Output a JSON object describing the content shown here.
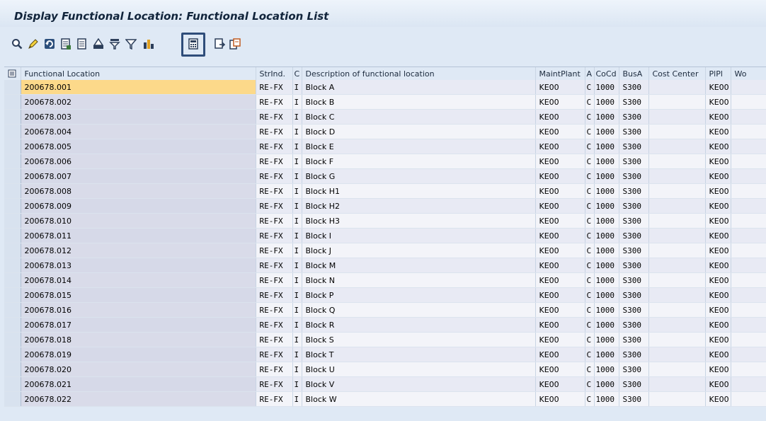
{
  "window": {
    "title": "Display Functional Location: Functional Location List"
  },
  "toolbar": {
    "buttons": [
      {
        "icon": "details-magnifier-icon"
      },
      {
        "icon": "edit-pencil-icon"
      },
      {
        "icon": "refresh-icon"
      },
      {
        "icon": "select-layout-icon"
      },
      {
        "icon": "choose-layout-icon"
      },
      {
        "icon": "print-icon"
      },
      {
        "icon": "filter-icon"
      },
      {
        "icon": "set-filter-icon"
      },
      {
        "icon": "chart-icon"
      },
      {
        "icon": "spreadsheet-icon"
      },
      {
        "icon": "export-icon"
      },
      {
        "icon": "local-file-icon"
      }
    ]
  },
  "table": {
    "columns": [
      "Functional Location",
      "StrInd.",
      "C",
      "Description of functional location",
      "MaintPlant",
      "A",
      "CoCd",
      "BusA",
      "Cost Center",
      "PlPl",
      "Wo"
    ],
    "rows": [
      [
        "200678.001",
        "RE-FX",
        "I",
        "Block A",
        "KE00",
        "C",
        "1000",
        "S300",
        "",
        "KE00",
        ""
      ],
      [
        "200678.002",
        "RE-FX",
        "I",
        "Block B",
        "KE00",
        "C",
        "1000",
        "S300",
        "",
        "KE00",
        ""
      ],
      [
        "200678.003",
        "RE-FX",
        "I",
        "Block C",
        "KE00",
        "C",
        "1000",
        "S300",
        "",
        "KE00",
        ""
      ],
      [
        "200678.004",
        "RE-FX",
        "I",
        "Block D",
        "KE00",
        "C",
        "1000",
        "S300",
        "",
        "KE00",
        ""
      ],
      [
        "200678.005",
        "RE-FX",
        "I",
        "Block E",
        "KE00",
        "C",
        "1000",
        "S300",
        "",
        "KE00",
        ""
      ],
      [
        "200678.006",
        "RE-FX",
        "I",
        "Block F",
        "KE00",
        "C",
        "1000",
        "S300",
        "",
        "KE00",
        ""
      ],
      [
        "200678.007",
        "RE-FX",
        "I",
        "Block G",
        "KE00",
        "C",
        "1000",
        "S300",
        "",
        "KE00",
        ""
      ],
      [
        "200678.008",
        "RE-FX",
        "I",
        "Block H1",
        "KE00",
        "C",
        "1000",
        "S300",
        "",
        "KE00",
        ""
      ],
      [
        "200678.009",
        "RE-FX",
        "I",
        "Block H2",
        "KE00",
        "C",
        "1000",
        "S300",
        "",
        "KE00",
        ""
      ],
      [
        "200678.010",
        "RE-FX",
        "I",
        "Block H3",
        "KE00",
        "C",
        "1000",
        "S300",
        "",
        "KE00",
        ""
      ],
      [
        "200678.011",
        "RE-FX",
        "I",
        "Block I",
        "KE00",
        "C",
        "1000",
        "S300",
        "",
        "KE00",
        ""
      ],
      [
        "200678.012",
        "RE-FX",
        "I",
        "Block J",
        "KE00",
        "C",
        "1000",
        "S300",
        "",
        "KE00",
        ""
      ],
      [
        "200678.013",
        "RE-FX",
        "I",
        "Block M",
        "KE00",
        "C",
        "1000",
        "S300",
        "",
        "KE00",
        ""
      ],
      [
        "200678.014",
        "RE-FX",
        "I",
        "Block N",
        "KE00",
        "C",
        "1000",
        "S300",
        "",
        "KE00",
        ""
      ],
      [
        "200678.015",
        "RE-FX",
        "I",
        "Block P",
        "KE00",
        "C",
        "1000",
        "S300",
        "",
        "KE00",
        ""
      ],
      [
        "200678.016",
        "RE-FX",
        "I",
        "Block Q",
        "KE00",
        "C",
        "1000",
        "S300",
        "",
        "KE00",
        ""
      ],
      [
        "200678.017",
        "RE-FX",
        "I",
        "Block R",
        "KE00",
        "C",
        "1000",
        "S300",
        "",
        "KE00",
        ""
      ],
      [
        "200678.018",
        "RE-FX",
        "I",
        "Block S",
        "KE00",
        "C",
        "1000",
        "S300",
        "",
        "KE00",
        ""
      ],
      [
        "200678.019",
        "RE-FX",
        "I",
        "Block T",
        "KE00",
        "C",
        "1000",
        "S300",
        "",
        "KE00",
        ""
      ],
      [
        "200678.020",
        "RE-FX",
        "I",
        "Block U",
        "KE00",
        "C",
        "1000",
        "S300",
        "",
        "KE00",
        ""
      ],
      [
        "200678.021",
        "RE-FX",
        "I",
        "Block V",
        "KE00",
        "C",
        "1000",
        "S300",
        "",
        "KE00",
        ""
      ],
      [
        "200678.022",
        "RE-FX",
        "I",
        "Block W",
        "KE00",
        "C",
        "1000",
        "S300",
        "",
        "KE00",
        ""
      ]
    ]
  }
}
